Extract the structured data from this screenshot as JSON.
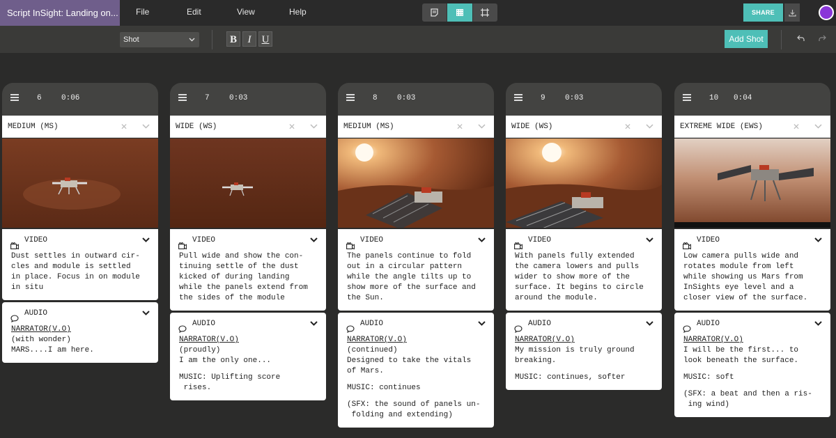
{
  "window": {
    "title": "Script InSight: Landing on..."
  },
  "menu": [
    "File",
    "Edit",
    "View",
    "Help"
  ],
  "colors": {
    "accent": "#4ebfb7",
    "title_bg": "#6f5e8b",
    "avatar": "#8a36d8"
  },
  "top_right": {
    "share_label": "SHARE"
  },
  "toolbar": {
    "shot_select_value": "Shot",
    "bold": "B",
    "italic": "I",
    "underline": "U",
    "add_shot_label": "Add Shot"
  },
  "shots": [
    {
      "number": "6",
      "duration": "0:06",
      "type": "MEDIUM (MS)",
      "video_label": "VIDEO",
      "video_text": "Dust settles in outward cir-\ncles and module is settled\nin place. Focus in on module\nin situ",
      "audio_label": "AUDIO",
      "audio_blocks": [
        {
          "speaker": "NARRATOR(V.O)",
          "text": "(with wonder)\nMARS....I am here."
        }
      ]
    },
    {
      "number": "7",
      "duration": "0:03",
      "type": "WIDE (WS)",
      "video_label": "VIDEO",
      "video_text": "Pull wide and show the con-\ntinuing settle of the dust\nkicked of during landing\nwhile the panels extend from\nthe sides of the module",
      "audio_label": "AUDIO",
      "audio_blocks": [
        {
          "speaker": "NARRATOR(V.O)",
          "text": "(proudly)\nI am the only one..."
        },
        {
          "speaker": "",
          "text": "MUSIC: Uplifting score\n rises."
        }
      ]
    },
    {
      "number": "8",
      "duration": "0:03",
      "type": "MEDIUM (MS)",
      "video_label": "VIDEO",
      "video_text": "The panels continue to fold\nout in a circular pattern\nwhile the angle tilts up to\nshow more of the surface and\nthe Sun.",
      "audio_label": "AUDIO",
      "audio_blocks": [
        {
          "speaker": "NARRATOR(V.O)",
          "text": "(continued)\nDesigned to take the vitals\nof Mars."
        },
        {
          "speaker": "",
          "text": "MUSIC: continues"
        },
        {
          "speaker": "",
          "text": "(SFX: the sound of panels un-\n folding and extending)"
        }
      ]
    },
    {
      "number": "9",
      "duration": "0:03",
      "type": "WIDE (WS)",
      "video_label": "VIDEO",
      "video_text": "With panels fully extended\nthe camera lowers and pulls\nwider to show more of the\nsurface. It begins to circle\naround the module.",
      "audio_label": "AUDIO",
      "audio_blocks": [
        {
          "speaker": "NARRATOR(V.O)",
          "text": "My mission is truly ground\nbreaking."
        },
        {
          "speaker": "",
          "text": "MUSIC: continues, softer"
        }
      ]
    },
    {
      "number": "10",
      "duration": "0:04",
      "type": "EXTREME WIDE (EWS)",
      "video_label": "VIDEO",
      "video_text": "Low camera pulls wide and\nrotates module from left\nwhile showing us Mars from\nInSights eye level and a\ncloser view of the surface.",
      "audio_label": "AUDIO",
      "audio_blocks": [
        {
          "speaker": "NARRATOR(V.O)",
          "text": "I will be the first... to\nlook beneath the surface."
        },
        {
          "speaker": "",
          "text": "MUSIC: soft"
        },
        {
          "speaker": "",
          "text": "(SFX: a beat and then a ris-\n ing wind)"
        }
      ]
    }
  ]
}
